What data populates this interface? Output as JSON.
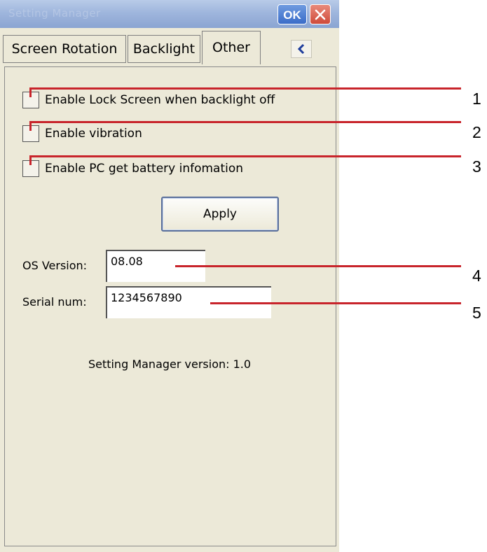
{
  "window": {
    "title": "Setting Manager",
    "ok_label": "OK"
  },
  "tabs": [
    {
      "label": "Screen Rotation"
    },
    {
      "label": "Backlight"
    },
    {
      "label": "Other"
    }
  ],
  "options": [
    {
      "label": "Enable Lock Screen when backlight off",
      "checked": false
    },
    {
      "label": "Enable vibration",
      "checked": false
    },
    {
      "label": "Enable PC get battery infomation",
      "checked": false
    }
  ],
  "apply_label": "Apply",
  "fields": {
    "os_version": {
      "label": "OS Version:",
      "value": "08.08"
    },
    "serial_num": {
      "label": "Serial num:",
      "value": "1234567890"
    }
  },
  "version_text": "Setting Manager version: 1.0",
  "callouts": [
    "1",
    "2",
    "3",
    "4",
    "5"
  ],
  "colors": {
    "callout_line": "#c8242b",
    "titlebar": "#9fb6dd",
    "panel_bg": "#ece9d8"
  }
}
